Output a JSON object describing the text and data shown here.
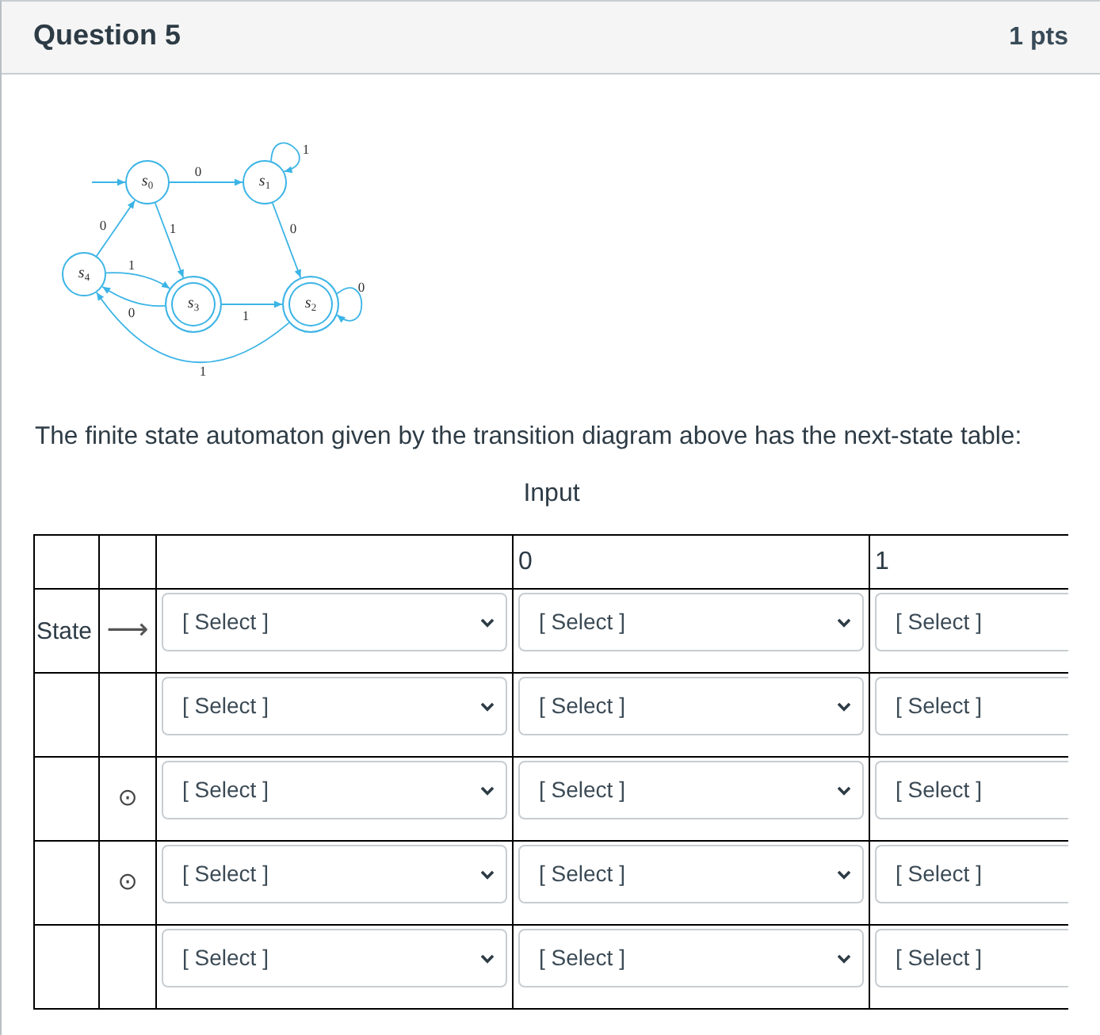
{
  "header": {
    "title": "Question 5",
    "points": "1 pts"
  },
  "diagram": {
    "nodes": [
      {
        "label": "*s*$_{0}$",
        "initial": true,
        "accepting": false
      },
      {
        "label": "*s*$_{1}$",
        "initial": false,
        "accepting": false
      },
      {
        "label": "*s*$_{4}$",
        "initial": false,
        "accepting": false
      },
      {
        "label": "*s*$_{3}$",
        "initial": false,
        "accepting": true
      },
      {
        "label": "*s*$_{2}$",
        "initial": false,
        "accepting": true
      }
    ],
    "edges": [
      {
        "kind": "loop",
        "label": "1"
      },
      {
        "kind": "line",
        "label": "0"
      },
      {
        "kind": "line",
        "label": "0"
      },
      {
        "kind": "line",
        "label": "1"
      },
      {
        "kind": "line",
        "label": "0"
      },
      {
        "kind": "curve",
        "label": "1"
      },
      {
        "kind": "loop",
        "label": "0"
      },
      {
        "kind": "curve",
        "label": "0"
      },
      {
        "kind": "line",
        "label": "1"
      },
      {
        "kind": "curve",
        "label": "1"
      }
    ]
  },
  "prompt": "The finite state automaton given by the transition diagram above has the next-state table:",
  "table": {
    "caption": "Input",
    "columns": [
      "0",
      "1"
    ],
    "rows": [
      {
        "label": "State",
        "marker": {
          "kind": "arrow",
          "text": "⟶"
        },
        "dropdowns": [
          "[ Select ]",
          "[ Select ]",
          "[ Select ]"
        ]
      },
      {
        "dropdowns": [
          "[ Select ]",
          "[ Select ]",
          "[ Select ]"
        ]
      },
      {
        "marker": {
          "kind": "dot",
          "text": "⊙"
        },
        "dropdowns": [
          "[ Select ]",
          "[ Select ]",
          "[ Select ]"
        ]
      },
      {
        "marker": {
          "kind": "dot",
          "text": "⊙"
        },
        "dropdowns": [
          "[ Select ]",
          "[ Select ]",
          "[ Select ]"
        ]
      },
      {
        "dropdowns": [
          "[ Select ]",
          "[ Select ]",
          "[ Select ]"
        ]
      }
    ]
  }
}
